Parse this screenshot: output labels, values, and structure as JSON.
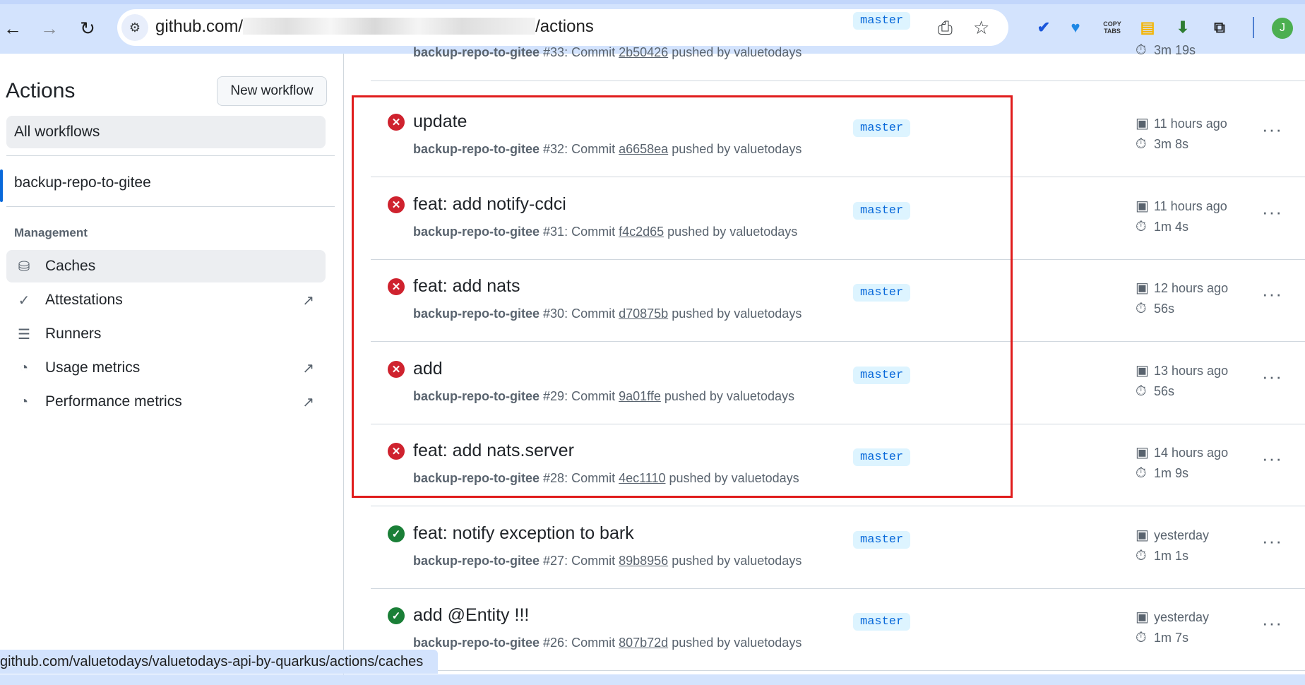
{
  "browser": {
    "url_prefix": "github.com/",
    "url_suffix": "/actions",
    "profile_initial": "J",
    "extensions": [
      {
        "name": "check-circle-icon",
        "label": "✔",
        "color": "#1a56db"
      },
      {
        "name": "heart-shield-icon",
        "label": "♥",
        "color": "#1e88e5"
      },
      {
        "name": "copy-tabs-icon",
        "label": "COPY TABS",
        "color": "#333333"
      },
      {
        "name": "file-note-icon",
        "label": "▤",
        "color": "#f4b400"
      },
      {
        "name": "download-note-icon",
        "label": "⬇",
        "color": "#2e7d32"
      },
      {
        "name": "puzzle-icon",
        "label": "⧉",
        "color": "#1f1f1f"
      }
    ]
  },
  "sidebar": {
    "title": "Actions",
    "new_workflow": "New workflow",
    "all_workflows": "All workflows",
    "workflow": "backup-repo-to-gitee",
    "management_heading": "Management",
    "management": [
      {
        "label": "Caches",
        "icon": "database-icon",
        "glyph": "⛁",
        "external": false
      },
      {
        "label": "Attestations",
        "icon": "verified-icon",
        "glyph": "✓",
        "external": true
      },
      {
        "label": "Runners",
        "icon": "server-icon",
        "glyph": "☰",
        "external": false
      },
      {
        "label": "Usage metrics",
        "icon": "meter-icon",
        "glyph": "◔",
        "external": true
      },
      {
        "label": "Performance metrics",
        "icon": "meter-icon",
        "glyph": "◔",
        "external": true
      }
    ]
  },
  "status_url": "github.com/valuetodays/valuetodays-api-by-quarkus/actions/caches",
  "runs": [
    {
      "title": "",
      "workflow": "backup-repo-to-gitee",
      "number": "#33: Commit",
      "sha": "2b50426",
      "pushed_by": "pushed by valuetodays",
      "branch": "master",
      "date": "",
      "duration": "3m 19s",
      "status": "partial"
    },
    {
      "title": "update",
      "workflow": "backup-repo-to-gitee",
      "number": "#32: Commit",
      "sha": "a6658ea",
      "pushed_by": "pushed by valuetodays",
      "branch": "master",
      "date": "11 hours ago",
      "duration": "3m 8s",
      "status": "fail"
    },
    {
      "title": "feat: add notify-cdci",
      "workflow": "backup-repo-to-gitee",
      "number": "#31: Commit",
      "sha": "f4c2d65",
      "pushed_by": "pushed by valuetodays",
      "branch": "master",
      "date": "11 hours ago",
      "duration": "1m 4s",
      "status": "fail"
    },
    {
      "title": "feat: add nats",
      "workflow": "backup-repo-to-gitee",
      "number": "#30: Commit",
      "sha": "d70875b",
      "pushed_by": "pushed by valuetodays",
      "branch": "master",
      "date": "12 hours ago",
      "duration": "56s",
      "status": "fail"
    },
    {
      "title": "add",
      "workflow": "backup-repo-to-gitee",
      "number": "#29: Commit",
      "sha": "9a01ffe",
      "pushed_by": "pushed by valuetodays",
      "branch": "master",
      "date": "13 hours ago",
      "duration": "56s",
      "status": "fail"
    },
    {
      "title": "feat: add nats.server",
      "workflow": "backup-repo-to-gitee",
      "number": "#28: Commit",
      "sha": "4ec1110",
      "pushed_by": "pushed by valuetodays",
      "branch": "master",
      "date": "14 hours ago",
      "duration": "1m 9s",
      "status": "fail"
    },
    {
      "title": "feat: notify exception to bark",
      "workflow": "backup-repo-to-gitee",
      "number": "#27: Commit",
      "sha": "89b8956",
      "pushed_by": "pushed by valuetodays",
      "branch": "master",
      "date": "yesterday",
      "duration": "1m 1s",
      "status": "ok"
    },
    {
      "title": "add @Entity !!!",
      "workflow": "backup-repo-to-gitee",
      "number": "#26: Commit",
      "sha": "807b72d",
      "pushed_by": "pushed by valuetodays",
      "branch": "master",
      "date": "yesterday",
      "duration": "1m 7s",
      "status": "ok"
    }
  ]
}
